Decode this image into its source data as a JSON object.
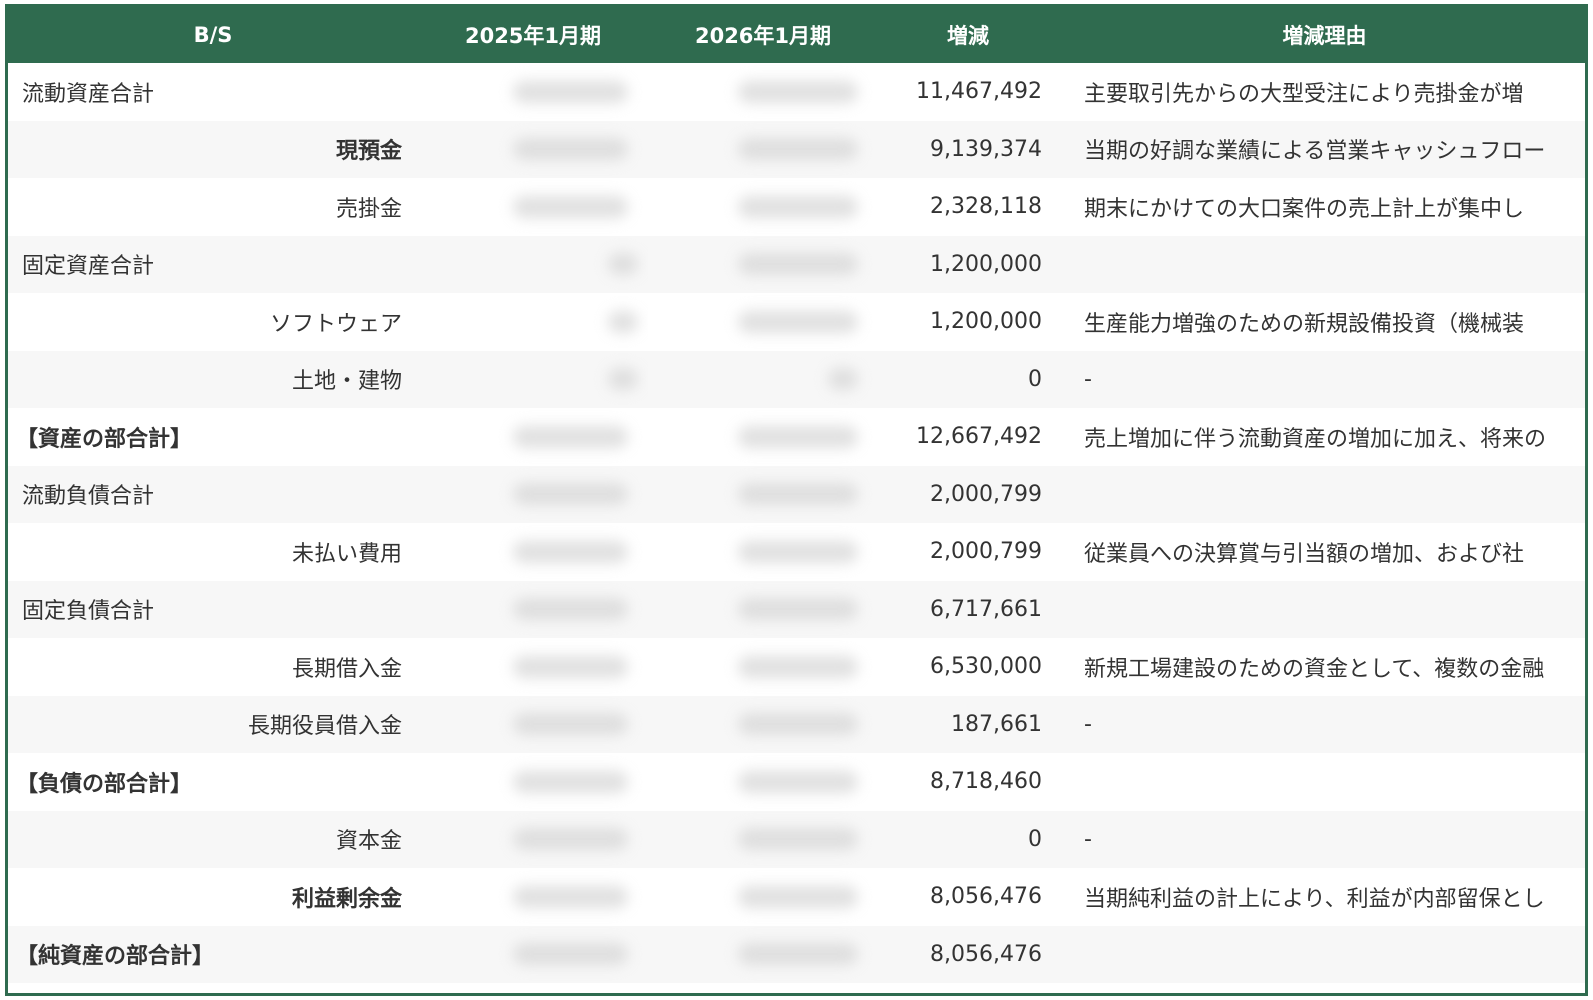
{
  "headers": [
    "B/S",
    "2025年1月期",
    "2026年1月期",
    "増減",
    "増減理由"
  ],
  "rows": [
    {
      "label": "流動資産合計",
      "change": "11,467,492",
      "reason": "主要取引先からの大型受注により売掛金が増"
    },
    {
      "label": "現預金",
      "change": "9,139,374",
      "reason": "当期の好調な業績による営業キャッシュフロー"
    },
    {
      "label": "売掛金",
      "change": "2,328,118",
      "reason": "期末にかけての大口案件の売上計上が集中し"
    },
    {
      "label": "固定資産合計",
      "change": "1,200,000",
      "reason": ""
    },
    {
      "label": "ソフトウェア",
      "change": "1,200,000",
      "reason": "生産能力増強のための新規設備投資（機械装"
    },
    {
      "label": "土地・建物",
      "change": "0",
      "reason": "-"
    },
    {
      "label": "【資産の部合計】",
      "change": "12,667,492",
      "reason": "売上増加に伴う流動資産の増加に加え、将来の"
    },
    {
      "label": "流動負債合計",
      "change": "2,000,799",
      "reason": ""
    },
    {
      "label": "未払い費用",
      "change": "2,000,799",
      "reason": "従業員への決算賞与引当額の増加、および社"
    },
    {
      "label": "固定負債合計",
      "change": "6,717,661",
      "reason": ""
    },
    {
      "label": "長期借入金",
      "change": "6,530,000",
      "reason": "新規工場建設のための資金として、複数の金融"
    },
    {
      "label": "長期役員借入金",
      "change": "187,661",
      "reason": "-"
    },
    {
      "label": "【負債の部合計】",
      "change": "8,718,460",
      "reason": ""
    },
    {
      "label": "資本金",
      "change": "0",
      "reason": "-"
    },
    {
      "label": "利益剰余金",
      "change": "8,056,476",
      "reason": "当期純利益の計上により、利益が内部留保とし"
    },
    {
      "label": "【純資産の部合計】",
      "change": "8,056,476",
      "reason": ""
    }
  ],
  "colors": {
    "header_bg": "#2f6b4f",
    "header_text": "#ffffff",
    "row_alt": "#f7f7f7"
  }
}
